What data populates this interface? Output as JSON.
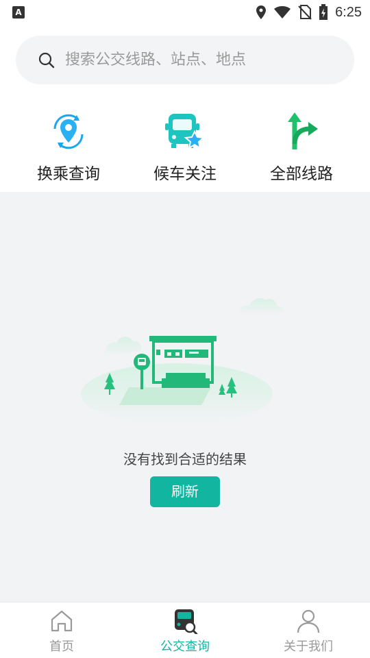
{
  "status_bar": {
    "time": "6:25",
    "left_badge": "A",
    "icons": [
      "location-icon",
      "wifi-icon",
      "no-sim-icon",
      "battery-charging-icon"
    ]
  },
  "search": {
    "placeholder": "搜索公交线路、站点、地点"
  },
  "quick_actions": [
    {
      "label": "换乘查询",
      "icon": "transfer-location-icon"
    },
    {
      "label": "候车关注",
      "icon": "bus-star-icon"
    },
    {
      "label": "全部线路",
      "icon": "route-arrows-icon"
    }
  ],
  "empty_state": {
    "message": "没有找到合适的结果",
    "refresh_label": "刷新",
    "illustration": "bus-stop-illustration"
  },
  "bottom_nav": {
    "items": [
      {
        "label": "首页",
        "icon": "home-icon",
        "active": false
      },
      {
        "label": "公交查询",
        "icon": "bus-search-icon",
        "active": true
      },
      {
        "label": "关于我们",
        "icon": "user-icon",
        "active": false
      }
    ]
  },
  "colors": {
    "accent": "#12b5a0",
    "blue": "#1aa7f0",
    "green": "#1fc26b",
    "background": "#f2f3f5"
  }
}
